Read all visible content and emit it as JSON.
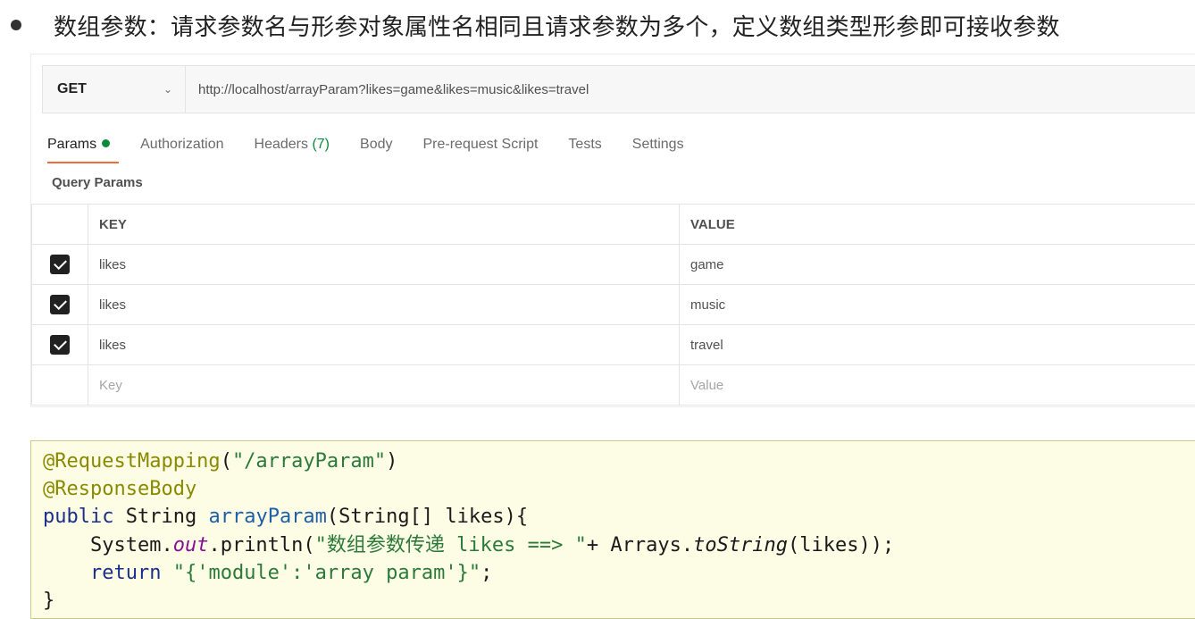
{
  "heading": {
    "text": "数组参数：请求参数名与形参对象属性名相同且请求参数为多个，定义数组类型形参即可接收参数"
  },
  "request": {
    "method": "GET",
    "url": "http://localhost/arrayParam?likes=game&likes=music&likes=travel"
  },
  "tabs": [
    {
      "label": "Params",
      "active": true,
      "dot": true
    },
    {
      "label": "Authorization"
    },
    {
      "label": "Headers",
      "count": "(7)"
    },
    {
      "label": "Body"
    },
    {
      "label": "Pre-request Script"
    },
    {
      "label": "Tests"
    },
    {
      "label": "Settings"
    }
  ],
  "query_params": {
    "title": "Query Params",
    "columns": {
      "key": "KEY",
      "value": "VALUE"
    },
    "rows": [
      {
        "checked": true,
        "key": "likes",
        "value": "game"
      },
      {
        "checked": true,
        "key": "likes",
        "value": "music"
      },
      {
        "checked": true,
        "key": "likes",
        "value": "travel"
      }
    ],
    "placeholder": {
      "key": "Key",
      "value": "Value"
    }
  },
  "colors": {
    "active_tab_underline": "#f26b3a",
    "params_dot": "#0c8a3c",
    "code_background": "#fdfde6"
  },
  "code": {
    "annotation1": "@RequestMapping",
    "annotation1_arg": "\"/arrayParam\"",
    "annotation2": "@ResponseBody",
    "kw_public": "public",
    "return_type": "String",
    "method_name": "arrayParam",
    "param_type": "String[]",
    "param_name": "likes",
    "system": "System.",
    "out": "out",
    "println": ".println(",
    "print_str": "\"数组参数传递 likes ==> \"",
    "concat": "+ Arrays.",
    "to_string": "toString",
    "to_string_arg": "(likes));",
    "kw_return": "return",
    "return_str": "\"{'module':'array param'}\"",
    "closing": "}"
  }
}
